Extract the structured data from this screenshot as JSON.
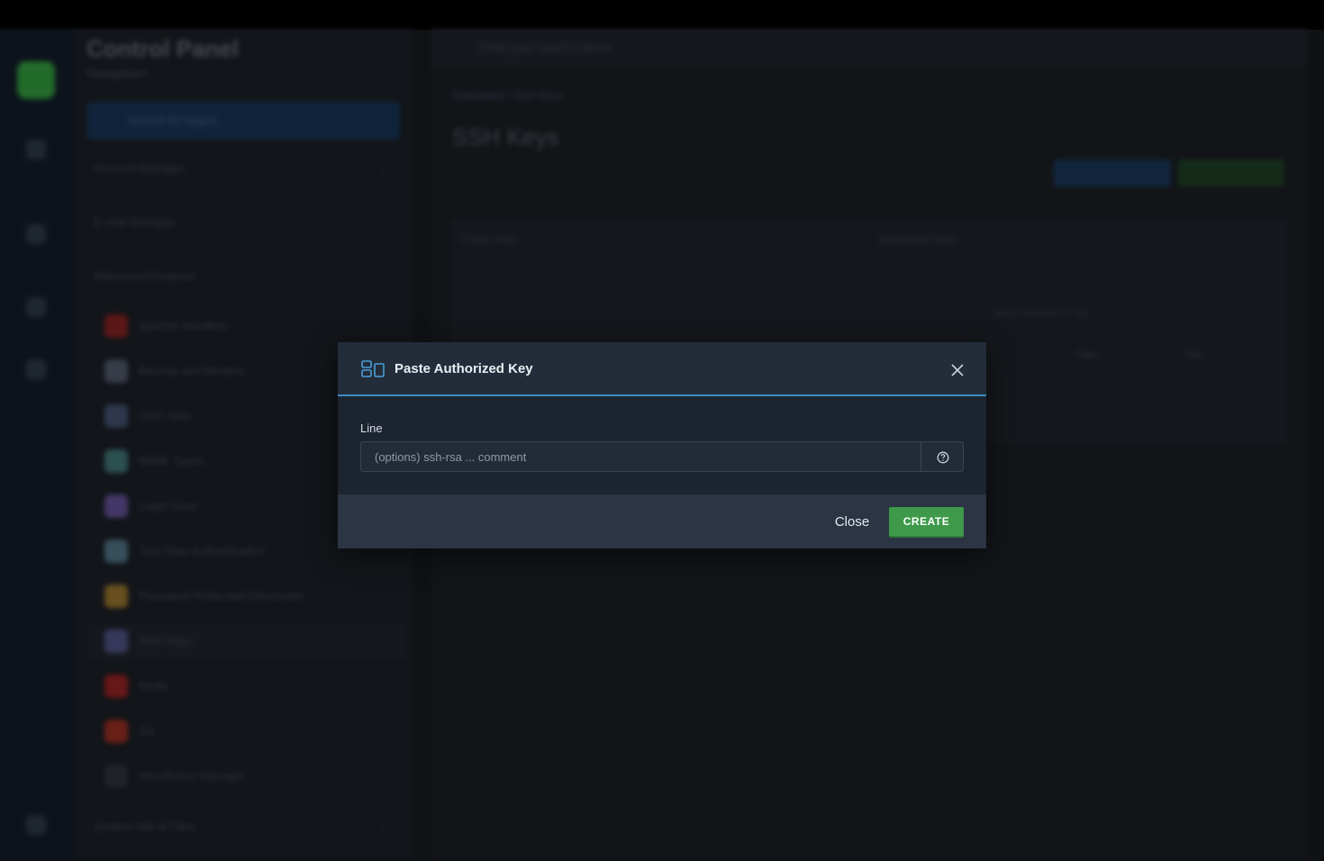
{
  "background": {
    "sidebar": {
      "title": "Control Panel",
      "subtitle": "Navigation",
      "search_placeholder": "Search for pages",
      "sections": [
        "Account Manager",
        "E-mail Manager",
        "Advanced Features"
      ],
      "items": [
        {
          "label": "Apache Handlers",
          "color": "#7a1f1f"
        },
        {
          "label": "Backup and Restore",
          "color": "#4a5060"
        },
        {
          "label": "Cron Jobs",
          "color": "#3e4a66"
        },
        {
          "label": "MIME Types",
          "color": "#3b6a6a"
        },
        {
          "label": "Login Keys",
          "color": "#5a4a8a"
        },
        {
          "label": "Two-Step Authentication",
          "color": "#4a6a7a"
        },
        {
          "label": "Password Protected Directories",
          "color": "#8a6a2a"
        },
        {
          "label": "SSH Keys",
          "color": "#4a4a7a"
        },
        {
          "label": "Redis",
          "color": "#8a1f1f"
        },
        {
          "label": "Git",
          "color": "#8a2a1f"
        },
        {
          "label": "WordPress Manager",
          "color": "#2a2e34"
        }
      ],
      "footer_section": "System Info & Files"
    },
    "topsearch_placeholder": "Enter your search criteria",
    "breadcrumb": "Dashboard / SSH Keys",
    "page_title": "SSH Keys",
    "tabs": [
      "Public Keys",
      "Authorized Keys"
    ],
    "table_meta": "Items selected: 0 / 10",
    "columns": [
      "Type",
      "Bits"
    ]
  },
  "modal": {
    "title": "Paste Authorized Key",
    "close_icon": "close-icon",
    "field_label": "Line",
    "input_value": "",
    "input_placeholder": "(options) ssh-rsa ... comment",
    "help_icon": "help-circle-icon",
    "close_label": "Close",
    "create_label": "CREATE",
    "colors": {
      "accent": "#3a8dc4",
      "create": "#3e9a4a"
    }
  }
}
